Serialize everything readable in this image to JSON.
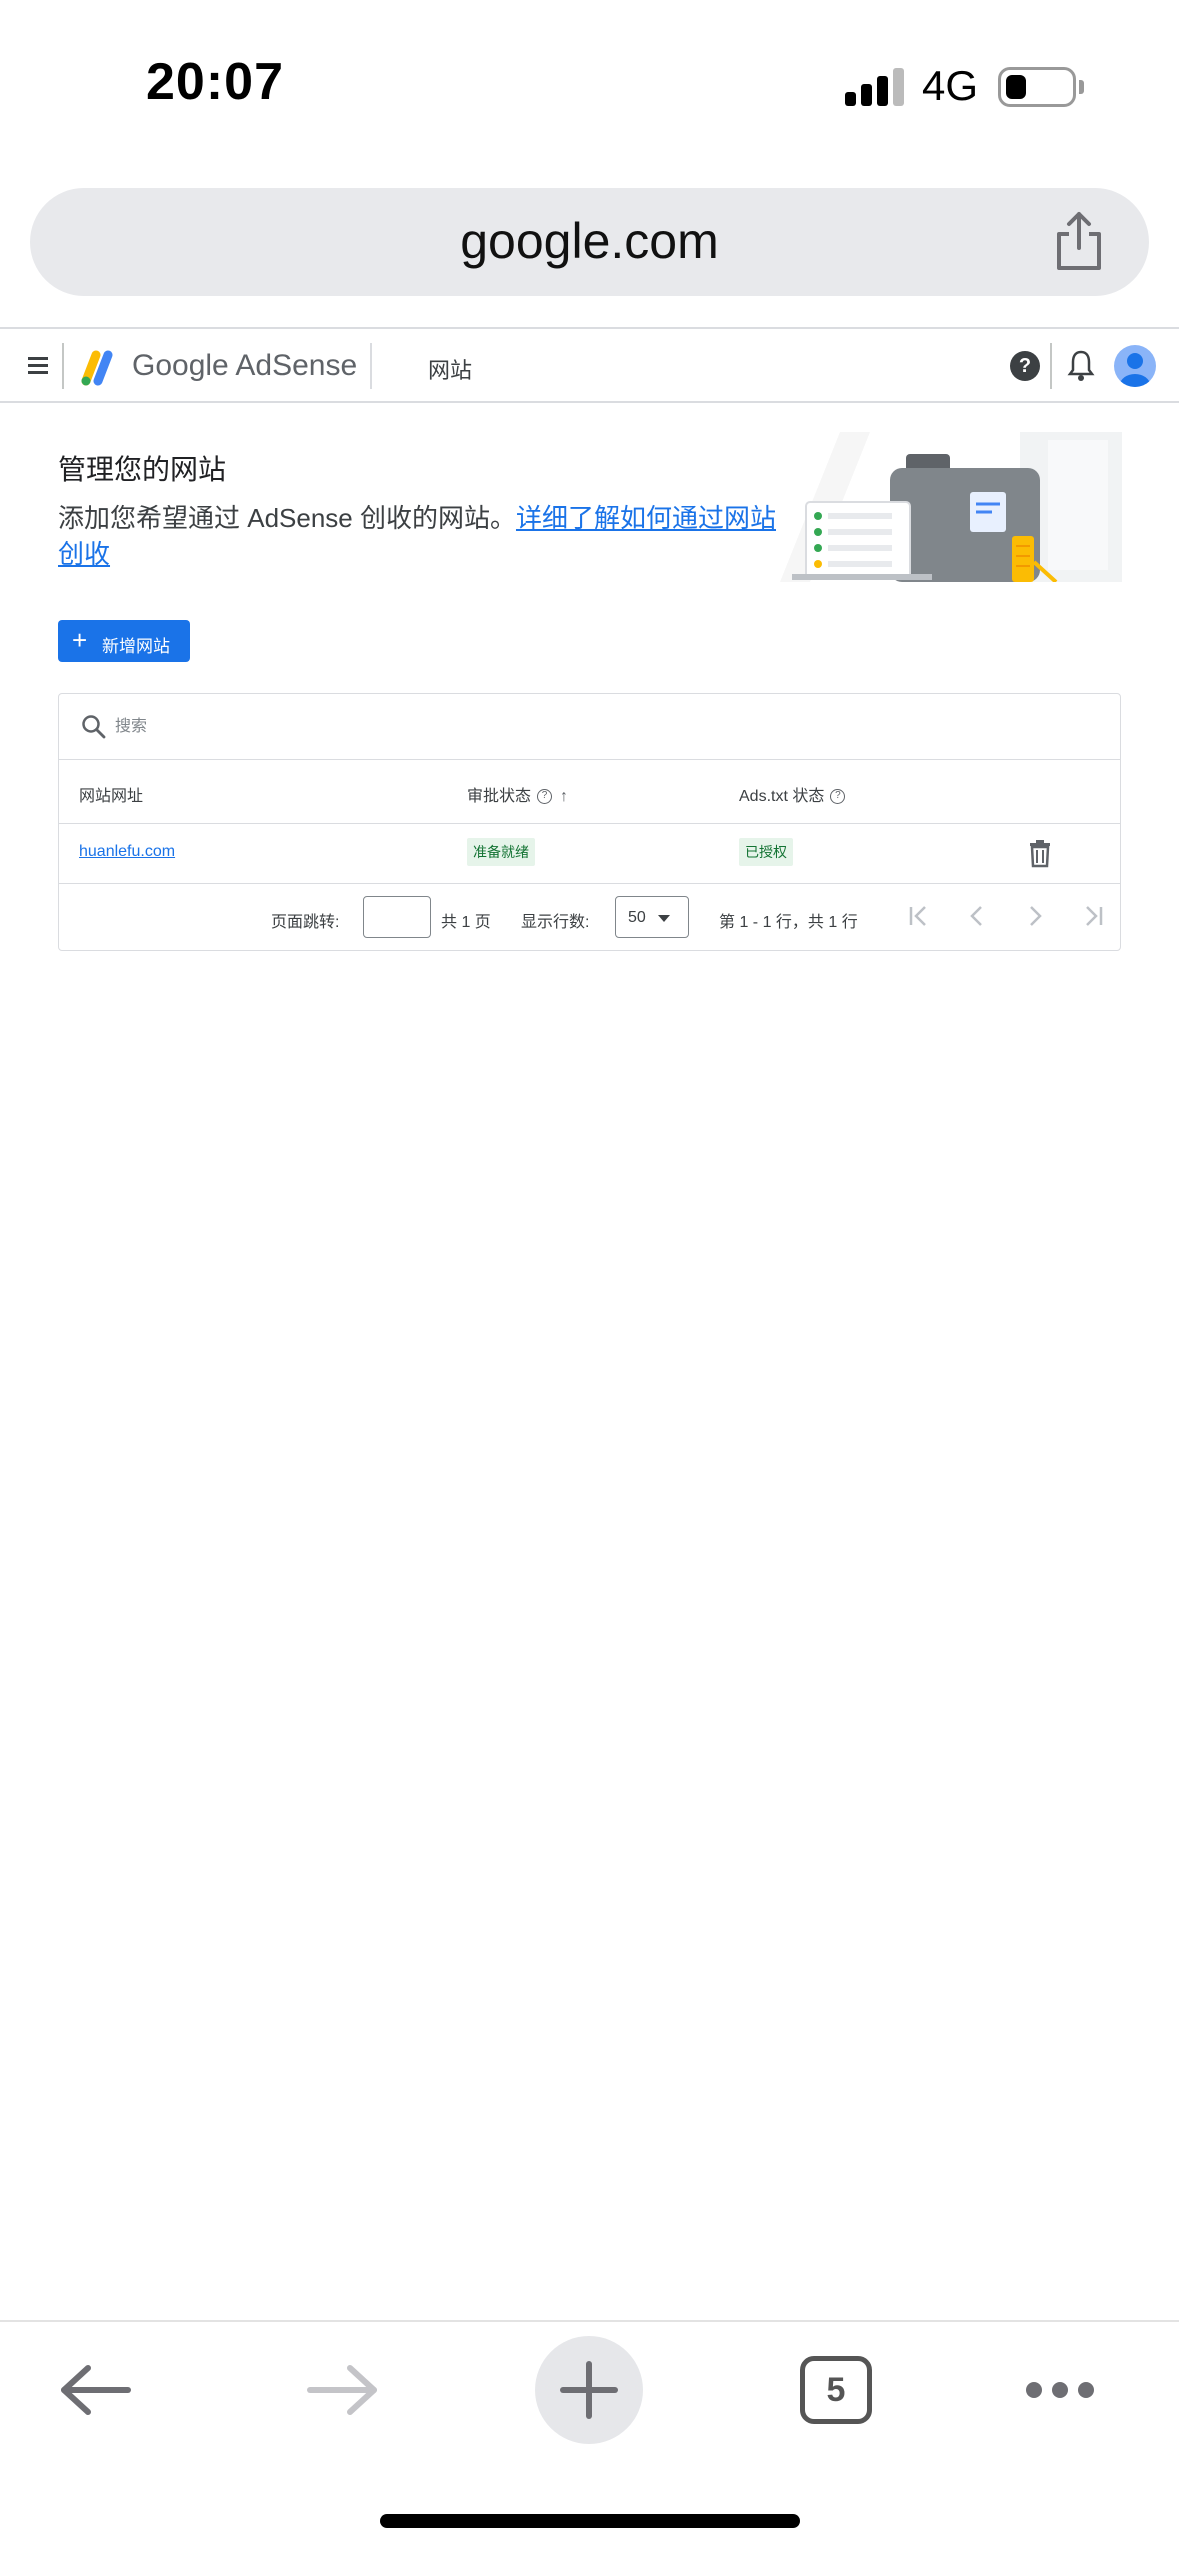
{
  "status_bar": {
    "time": "20:07",
    "network": "4G"
  },
  "browser": {
    "url": "google.com",
    "tab_count": "5"
  },
  "app": {
    "brand": "Google AdSense",
    "section": "网站"
  },
  "page": {
    "title": "管理您的网站",
    "intro_text": "添加您希望通过 AdSense 创收的网站。",
    "intro_link": "详细了解如何通过网站创收",
    "add_button_label": "新增网站"
  },
  "table": {
    "search_placeholder": "搜索",
    "columns": {
      "site": "网站网址",
      "approval": "审批状态",
      "ads_txt": "Ads.txt 状态"
    },
    "rows": [
      {
        "site": "huanlefu.com",
        "approval": "准备就绪",
        "ads_txt": "已授权"
      }
    ]
  },
  "pagination": {
    "jump_label": "页面跳转:",
    "total_pages": "共 1 页",
    "rows_label": "显示行数:",
    "rows_value": "50",
    "range_text": "第 1 - 1 行，共 1 行"
  },
  "colors": {
    "accent": "#1a73e8",
    "chip_bg": "#e6f4ea",
    "chip_text": "#137333"
  }
}
